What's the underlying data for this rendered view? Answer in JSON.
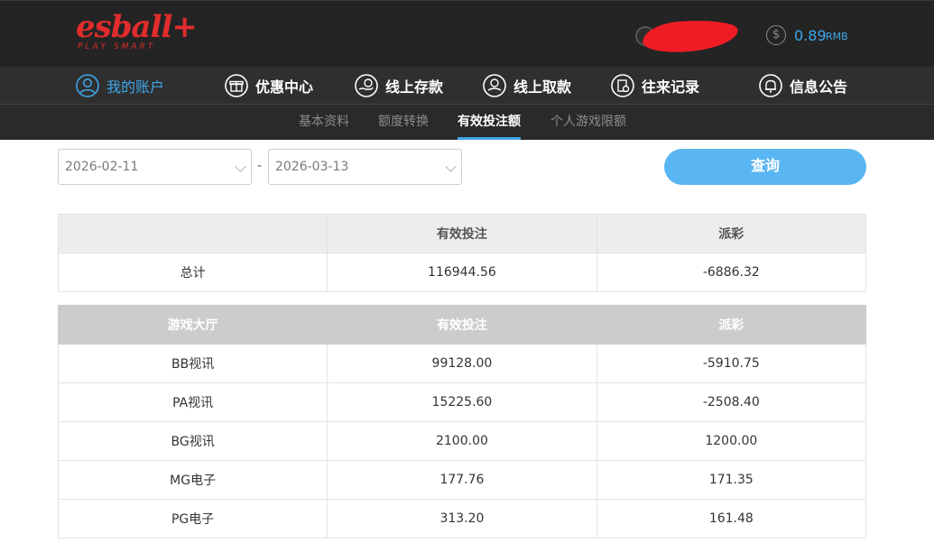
{
  "header": {
    "logo_text": "esball",
    "logo_plus": "+",
    "logo_tagline": "PLAY SMART",
    "username": "",
    "balance_icon": "$",
    "balance_amount": "0.89",
    "balance_unit": "RMB",
    "colors": {
      "brand": "#e02c2c",
      "accent": "#3fa5ea",
      "redaction": "#ef1c24"
    }
  },
  "nav": {
    "items": [
      {
        "label": "我的账户",
        "icon": "user-icon",
        "active": true
      },
      {
        "label": "优惠中心",
        "icon": "gift-icon"
      },
      {
        "label": "线上存款",
        "icon": "deposit-icon"
      },
      {
        "label": "线上取款",
        "icon": "withdraw-icon"
      },
      {
        "label": "往来记录",
        "icon": "records-icon"
      },
      {
        "label": "信息公告",
        "icon": "bell-icon"
      }
    ]
  },
  "subnav": {
    "items": [
      {
        "label": "基本资料"
      },
      {
        "label": "额度转换"
      },
      {
        "label": "有效投注额",
        "active": true
      },
      {
        "label": "个人游戏限额"
      }
    ]
  },
  "filter": {
    "start_date": "2026-02-11",
    "separator": "-",
    "end_date": "2026-03-13",
    "query_label": "查询"
  },
  "summary": {
    "headers": [
      "",
      "有效投注",
      "派彩"
    ],
    "row": {
      "label": "总计",
      "bets": "116944.56",
      "payout": "-6886.32"
    }
  },
  "detail": {
    "headers": [
      "游戏大厅",
      "有效投注",
      "派彩"
    ],
    "rows": [
      {
        "hall": "BB视讯",
        "bets": "99128.00",
        "payout": "-5910.75"
      },
      {
        "hall": "PA视讯",
        "bets": "15225.60",
        "payout": "-2508.40"
      },
      {
        "hall": "BG视讯",
        "bets": "2100.00",
        "payout": "1200.00"
      },
      {
        "hall": "MG电子",
        "bets": "177.76",
        "payout": "171.35"
      },
      {
        "hall": "PG电子",
        "bets": "313.20",
        "payout": "161.48"
      }
    ]
  }
}
